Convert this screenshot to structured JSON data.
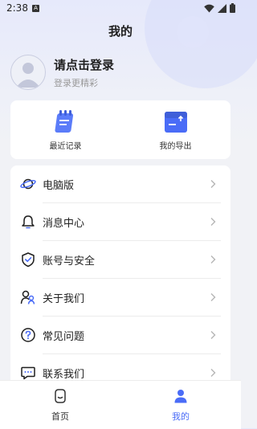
{
  "status_bar": {
    "time": "2:38",
    "notification_letter": "A"
  },
  "header": {
    "title": "我的"
  },
  "profile": {
    "title": "请点击登录",
    "subtitle": "登录更精彩"
  },
  "quick_actions": [
    {
      "label": "最近记录",
      "icon": "notebook-icon"
    },
    {
      "label": "我的导出",
      "icon": "export-folder-icon"
    }
  ],
  "menu": [
    {
      "label": "电脑版",
      "icon": "planet-icon"
    },
    {
      "label": "消息中心",
      "icon": "bell-icon"
    },
    {
      "label": "账号与安全",
      "icon": "shield-check-icon"
    },
    {
      "label": "关于我们",
      "icon": "people-icon"
    },
    {
      "label": "常见问题",
      "icon": "question-icon"
    },
    {
      "label": "联系我们",
      "icon": "chat-icon"
    }
  ],
  "tabs": [
    {
      "label": "首页",
      "icon": "home-face-icon",
      "active": false
    },
    {
      "label": "我的",
      "icon": "person-icon",
      "active": true
    }
  ],
  "colors": {
    "accent": "#4a6cf7",
    "text": "#1f1f1f",
    "muted": "#9a9a9a",
    "background": "#f1f2f6"
  }
}
